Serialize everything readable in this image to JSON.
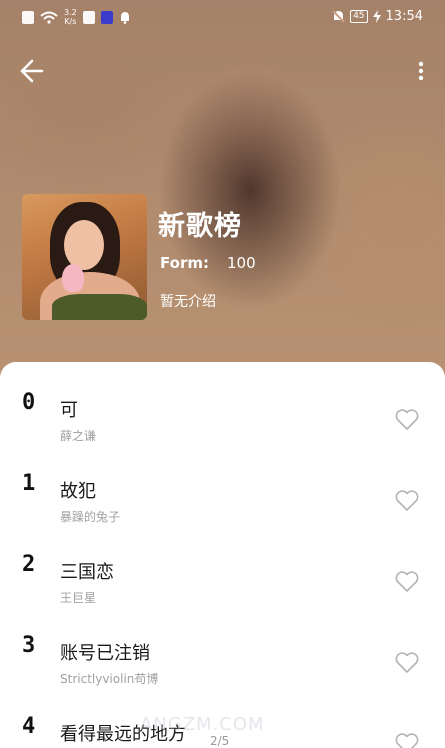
{
  "status_bar": {
    "speed": "3.2\nK/s",
    "battery": "45",
    "time": "13:54"
  },
  "icons": {
    "back": "back-arrow-icon",
    "more": "more-vertical-icon",
    "favorite": "heart-outline-icon"
  },
  "album": {
    "title": "新歌榜",
    "form_label": "Form:",
    "form_value": "100",
    "description": "暂无介绍"
  },
  "songs": [
    {
      "index": "0",
      "name": "可",
      "artist": "薛之谦"
    },
    {
      "index": "1",
      "name": "故犯",
      "artist": "暴躁的兔子"
    },
    {
      "index": "2",
      "name": "三国恋",
      "artist": "王巨星"
    },
    {
      "index": "3",
      "name": "账号已注销",
      "artist": "Strictlyviolin苟博"
    },
    {
      "index": "4",
      "name": "看得最远的地方",
      "artist": ""
    }
  ],
  "pager": "2/5",
  "watermark": "ANGZM.COM",
  "colors": {
    "header_tint": "#c79f80",
    "text_primary": "#1a1a1a",
    "text_secondary": "#a0a0a0"
  }
}
